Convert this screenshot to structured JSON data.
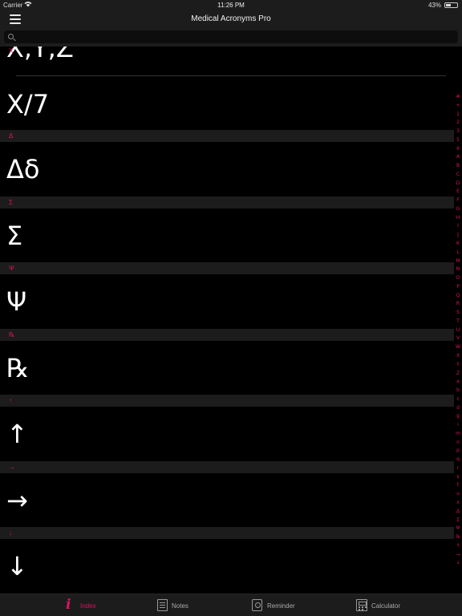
{
  "status": {
    "carrier": "Carrier",
    "time": "11:26 PM",
    "battery": "43%"
  },
  "nav": {
    "title": "Medical Acronyms Pro"
  },
  "search": {
    "placeholder": ""
  },
  "accent_color": "#e0115f",
  "list": {
    "partial_top_row": "X,Y,Z",
    "sections": [
      {
        "header": "X",
        "rows": [
          "X/7"
        ]
      },
      {
        "header": "Δ",
        "rows": [
          "Δδ"
        ]
      },
      {
        "header": "Σ",
        "rows": [
          "Σ"
        ]
      },
      {
        "header": "Ψ",
        "rows": [
          "Ψ"
        ]
      },
      {
        "header": "℞",
        "rows": [
          "℞"
        ]
      },
      {
        "header": "↑",
        "rows": [
          "↑"
        ]
      },
      {
        "header": "→",
        "rows": [
          "→"
        ]
      },
      {
        "header": "↓",
        "rows": [
          "↓"
        ]
      }
    ]
  },
  "index_letters": [
    "#",
    "+",
    "1",
    "2",
    "3",
    "5",
    "6",
    "A",
    "B",
    "C",
    "D",
    "E",
    "F",
    "G",
    "H",
    "I",
    "J",
    "K",
    "L",
    "M",
    "N",
    "O",
    "P",
    "Q",
    "R",
    "S",
    "T",
    "U",
    "V",
    "W",
    "X",
    "Y",
    "Z",
    "a",
    "b",
    "c",
    "d",
    "g",
    "i",
    "m",
    "n",
    "p",
    "q",
    "r",
    "s",
    "t",
    "u",
    "x",
    "Δ",
    "Σ",
    "Ψ",
    "℞",
    "↑",
    "→",
    "↓"
  ],
  "tabs": [
    {
      "label": "Index",
      "icon": "info-icon"
    },
    {
      "label": "Notes",
      "icon": "notes-icon"
    },
    {
      "label": "Reminder",
      "icon": "reminder-icon"
    },
    {
      "label": "Calculator",
      "icon": "calculator-icon"
    }
  ]
}
